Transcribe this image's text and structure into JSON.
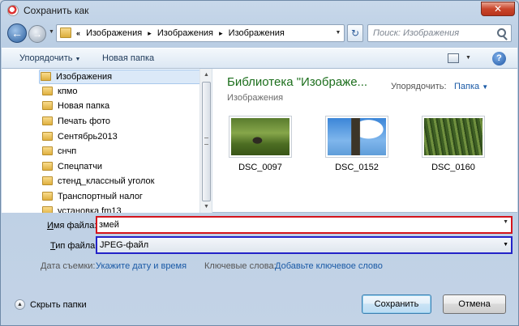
{
  "window": {
    "title": "Сохранить как",
    "close_label": "✕"
  },
  "nav": {
    "back_icon": "←",
    "forward_icon": "→",
    "address": {
      "prefix": "«",
      "segments": [
        "Изображения",
        "Изображения",
        "Изображения"
      ],
      "separator": "▸"
    },
    "refresh_icon": "↻",
    "search_placeholder": "Поиск: Изображения"
  },
  "toolbar": {
    "organize_label": "Упорядочить",
    "new_folder_label": "Новая папка",
    "help_label": "?"
  },
  "sidebar": {
    "items": [
      {
        "label": "Изображения",
        "selected": true
      },
      {
        "label": "кпмо"
      },
      {
        "label": "Новая папка"
      },
      {
        "label": "Печать фото"
      },
      {
        "label": "Сентябрь2013"
      },
      {
        "label": "снчп"
      },
      {
        "label": "Спецпатчи"
      },
      {
        "label": "стенд_классный уголок"
      },
      {
        "label": "Транспортный налог"
      },
      {
        "label": "установка fm13"
      }
    ]
  },
  "library": {
    "title": "Библиотека \"Изображе...",
    "subtitle": "Изображения",
    "arrange_label": "Упорядочить:",
    "arrange_value": "Папка",
    "files": [
      {
        "name": "DSC_0097",
        "thumb": "dark-object-on-grass"
      },
      {
        "name": "DSC_0152",
        "thumb": "sculpture-against-sky"
      },
      {
        "name": "DSC_0160",
        "thumb": "tall-grass-field"
      }
    ]
  },
  "form": {
    "filename_label_underlined": "И",
    "filename_label_rest": "мя файла:",
    "filename_value": "змей",
    "filetype_label_underlined": "Т",
    "filetype_label_rest": "ип файла:",
    "filetype_value": "JPEG-файл",
    "date_label": "Дата съемки:",
    "date_link": "Укажите дату и время",
    "keywords_label": "Ключевые слова:",
    "keywords_link": "Добавьте ключевое слово"
  },
  "footer": {
    "hide_folders_label": "Скрыть папки",
    "save_label": "Сохранить",
    "cancel_label": "Отмена"
  },
  "colors": {
    "filename_highlight": "#d4141c",
    "filetype_highlight": "#2323c8",
    "library_title": "#1c6e1c",
    "link": "#1a5aa6"
  }
}
